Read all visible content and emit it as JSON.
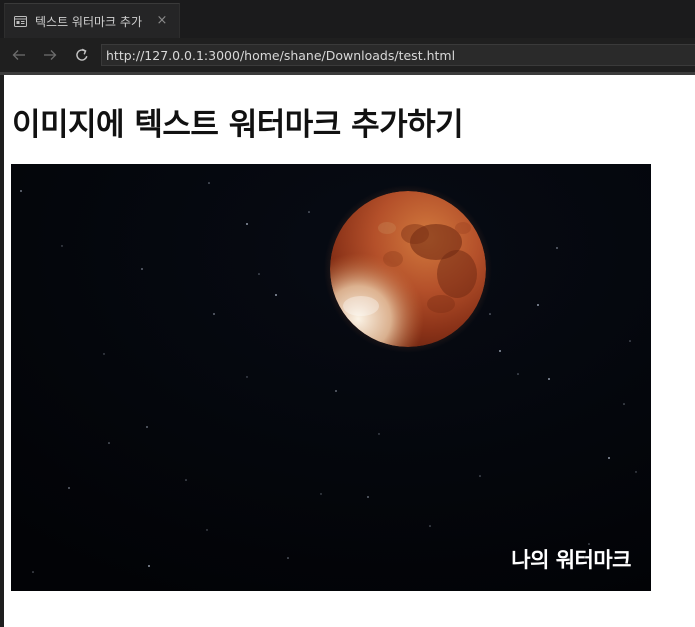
{
  "browser": {
    "tab": {
      "title": "텍스트 워터마크 추가",
      "close_glyph": "×"
    },
    "address_bar": {
      "url": "http://127.0.0.1:3000/home/shane/Downloads/test.html"
    }
  },
  "page": {
    "heading": "이미지에 텍스트 워터마크 추가하기",
    "image": {
      "subject": "blood moon",
      "watermark_text": "나의 워터마크"
    }
  },
  "colors": {
    "moon_red": "#a3401c",
    "moon_orange": "#c8743e",
    "moon_light": "#f0e2cf",
    "watermark": "#ffffff"
  }
}
